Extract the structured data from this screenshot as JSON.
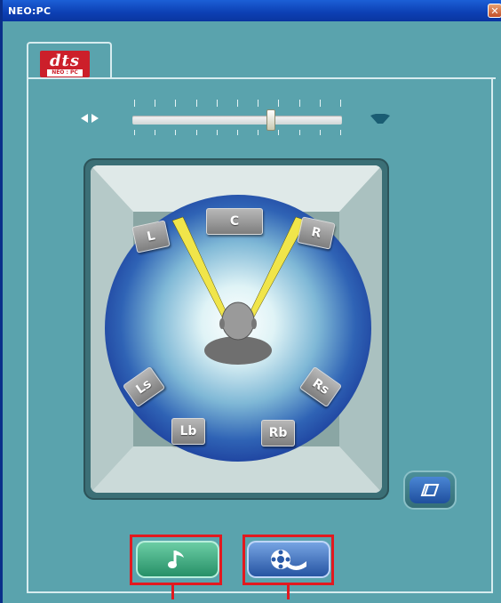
{
  "window": {
    "title": "NEO:PC",
    "close_glyph": "✕"
  },
  "tab": {
    "logo_text": "dts",
    "logo_subtext": "NEO : PC"
  },
  "slider": {
    "value_fraction": 0.66,
    "left_icon": "narrow-spread-icon",
    "right_icon": "wide-spread-icon"
  },
  "room": {
    "speakers": {
      "front_left": "L",
      "center": "C",
      "front_right": "R",
      "left_surround": "Ls",
      "right_surround": "Rs",
      "left_back": "Lb",
      "right_back": "Rb"
    },
    "listener_icon": "listener-head-icon"
  },
  "buttons": {
    "reset_icon": "eraser-icon",
    "music_icon": "music-note-icon",
    "movie_icon": "film-reel-icon"
  },
  "colors": {
    "window_bg": "#5aa3ad",
    "titlebar": "#0c3fb3",
    "sphere_edge": "#1b3c9b",
    "sphere_center": "#ffffff",
    "beam": "#f0e54a",
    "highlight": "#e2191f",
    "logo_red": "#cc1f2a"
  }
}
